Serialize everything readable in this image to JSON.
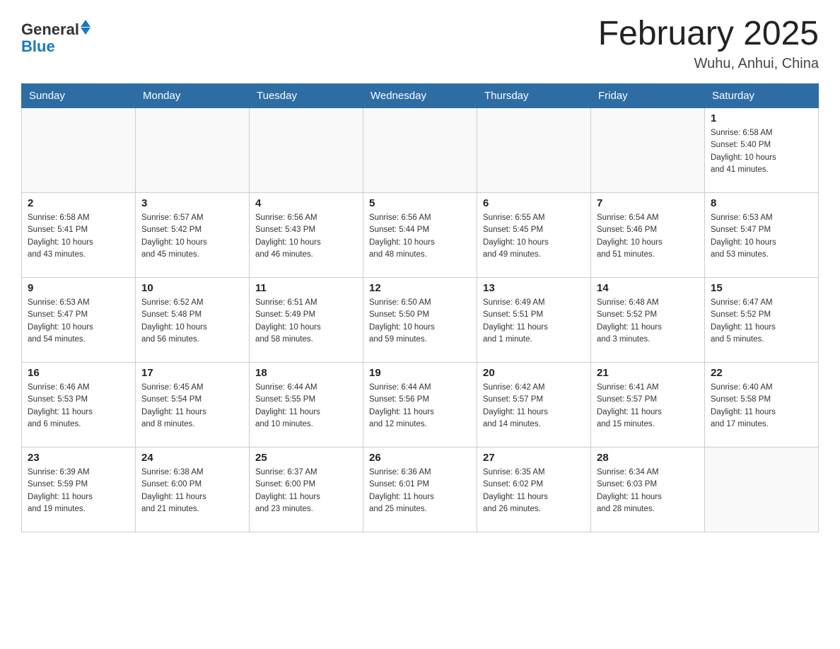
{
  "header": {
    "logo_general": "General",
    "logo_blue": "Blue",
    "title": "February 2025",
    "location": "Wuhu, Anhui, China"
  },
  "days_of_week": [
    "Sunday",
    "Monday",
    "Tuesday",
    "Wednesday",
    "Thursday",
    "Friday",
    "Saturday"
  ],
  "weeks": [
    [
      {
        "day": "",
        "info": ""
      },
      {
        "day": "",
        "info": ""
      },
      {
        "day": "",
        "info": ""
      },
      {
        "day": "",
        "info": ""
      },
      {
        "day": "",
        "info": ""
      },
      {
        "day": "",
        "info": ""
      },
      {
        "day": "1",
        "info": "Sunrise: 6:58 AM\nSunset: 5:40 PM\nDaylight: 10 hours\nand 41 minutes."
      }
    ],
    [
      {
        "day": "2",
        "info": "Sunrise: 6:58 AM\nSunset: 5:41 PM\nDaylight: 10 hours\nand 43 minutes."
      },
      {
        "day": "3",
        "info": "Sunrise: 6:57 AM\nSunset: 5:42 PM\nDaylight: 10 hours\nand 45 minutes."
      },
      {
        "day": "4",
        "info": "Sunrise: 6:56 AM\nSunset: 5:43 PM\nDaylight: 10 hours\nand 46 minutes."
      },
      {
        "day": "5",
        "info": "Sunrise: 6:56 AM\nSunset: 5:44 PM\nDaylight: 10 hours\nand 48 minutes."
      },
      {
        "day": "6",
        "info": "Sunrise: 6:55 AM\nSunset: 5:45 PM\nDaylight: 10 hours\nand 49 minutes."
      },
      {
        "day": "7",
        "info": "Sunrise: 6:54 AM\nSunset: 5:46 PM\nDaylight: 10 hours\nand 51 minutes."
      },
      {
        "day": "8",
        "info": "Sunrise: 6:53 AM\nSunset: 5:47 PM\nDaylight: 10 hours\nand 53 minutes."
      }
    ],
    [
      {
        "day": "9",
        "info": "Sunrise: 6:53 AM\nSunset: 5:47 PM\nDaylight: 10 hours\nand 54 minutes."
      },
      {
        "day": "10",
        "info": "Sunrise: 6:52 AM\nSunset: 5:48 PM\nDaylight: 10 hours\nand 56 minutes."
      },
      {
        "day": "11",
        "info": "Sunrise: 6:51 AM\nSunset: 5:49 PM\nDaylight: 10 hours\nand 58 minutes."
      },
      {
        "day": "12",
        "info": "Sunrise: 6:50 AM\nSunset: 5:50 PM\nDaylight: 10 hours\nand 59 minutes."
      },
      {
        "day": "13",
        "info": "Sunrise: 6:49 AM\nSunset: 5:51 PM\nDaylight: 11 hours\nand 1 minute."
      },
      {
        "day": "14",
        "info": "Sunrise: 6:48 AM\nSunset: 5:52 PM\nDaylight: 11 hours\nand 3 minutes."
      },
      {
        "day": "15",
        "info": "Sunrise: 6:47 AM\nSunset: 5:52 PM\nDaylight: 11 hours\nand 5 minutes."
      }
    ],
    [
      {
        "day": "16",
        "info": "Sunrise: 6:46 AM\nSunset: 5:53 PM\nDaylight: 11 hours\nand 6 minutes."
      },
      {
        "day": "17",
        "info": "Sunrise: 6:45 AM\nSunset: 5:54 PM\nDaylight: 11 hours\nand 8 minutes."
      },
      {
        "day": "18",
        "info": "Sunrise: 6:44 AM\nSunset: 5:55 PM\nDaylight: 11 hours\nand 10 minutes."
      },
      {
        "day": "19",
        "info": "Sunrise: 6:44 AM\nSunset: 5:56 PM\nDaylight: 11 hours\nand 12 minutes."
      },
      {
        "day": "20",
        "info": "Sunrise: 6:42 AM\nSunset: 5:57 PM\nDaylight: 11 hours\nand 14 minutes."
      },
      {
        "day": "21",
        "info": "Sunrise: 6:41 AM\nSunset: 5:57 PM\nDaylight: 11 hours\nand 15 minutes."
      },
      {
        "day": "22",
        "info": "Sunrise: 6:40 AM\nSunset: 5:58 PM\nDaylight: 11 hours\nand 17 minutes."
      }
    ],
    [
      {
        "day": "23",
        "info": "Sunrise: 6:39 AM\nSunset: 5:59 PM\nDaylight: 11 hours\nand 19 minutes."
      },
      {
        "day": "24",
        "info": "Sunrise: 6:38 AM\nSunset: 6:00 PM\nDaylight: 11 hours\nand 21 minutes."
      },
      {
        "day": "25",
        "info": "Sunrise: 6:37 AM\nSunset: 6:00 PM\nDaylight: 11 hours\nand 23 minutes."
      },
      {
        "day": "26",
        "info": "Sunrise: 6:36 AM\nSunset: 6:01 PM\nDaylight: 11 hours\nand 25 minutes."
      },
      {
        "day": "27",
        "info": "Sunrise: 6:35 AM\nSunset: 6:02 PM\nDaylight: 11 hours\nand 26 minutes."
      },
      {
        "day": "28",
        "info": "Sunrise: 6:34 AM\nSunset: 6:03 PM\nDaylight: 11 hours\nand 28 minutes."
      },
      {
        "day": "",
        "info": ""
      }
    ]
  ]
}
